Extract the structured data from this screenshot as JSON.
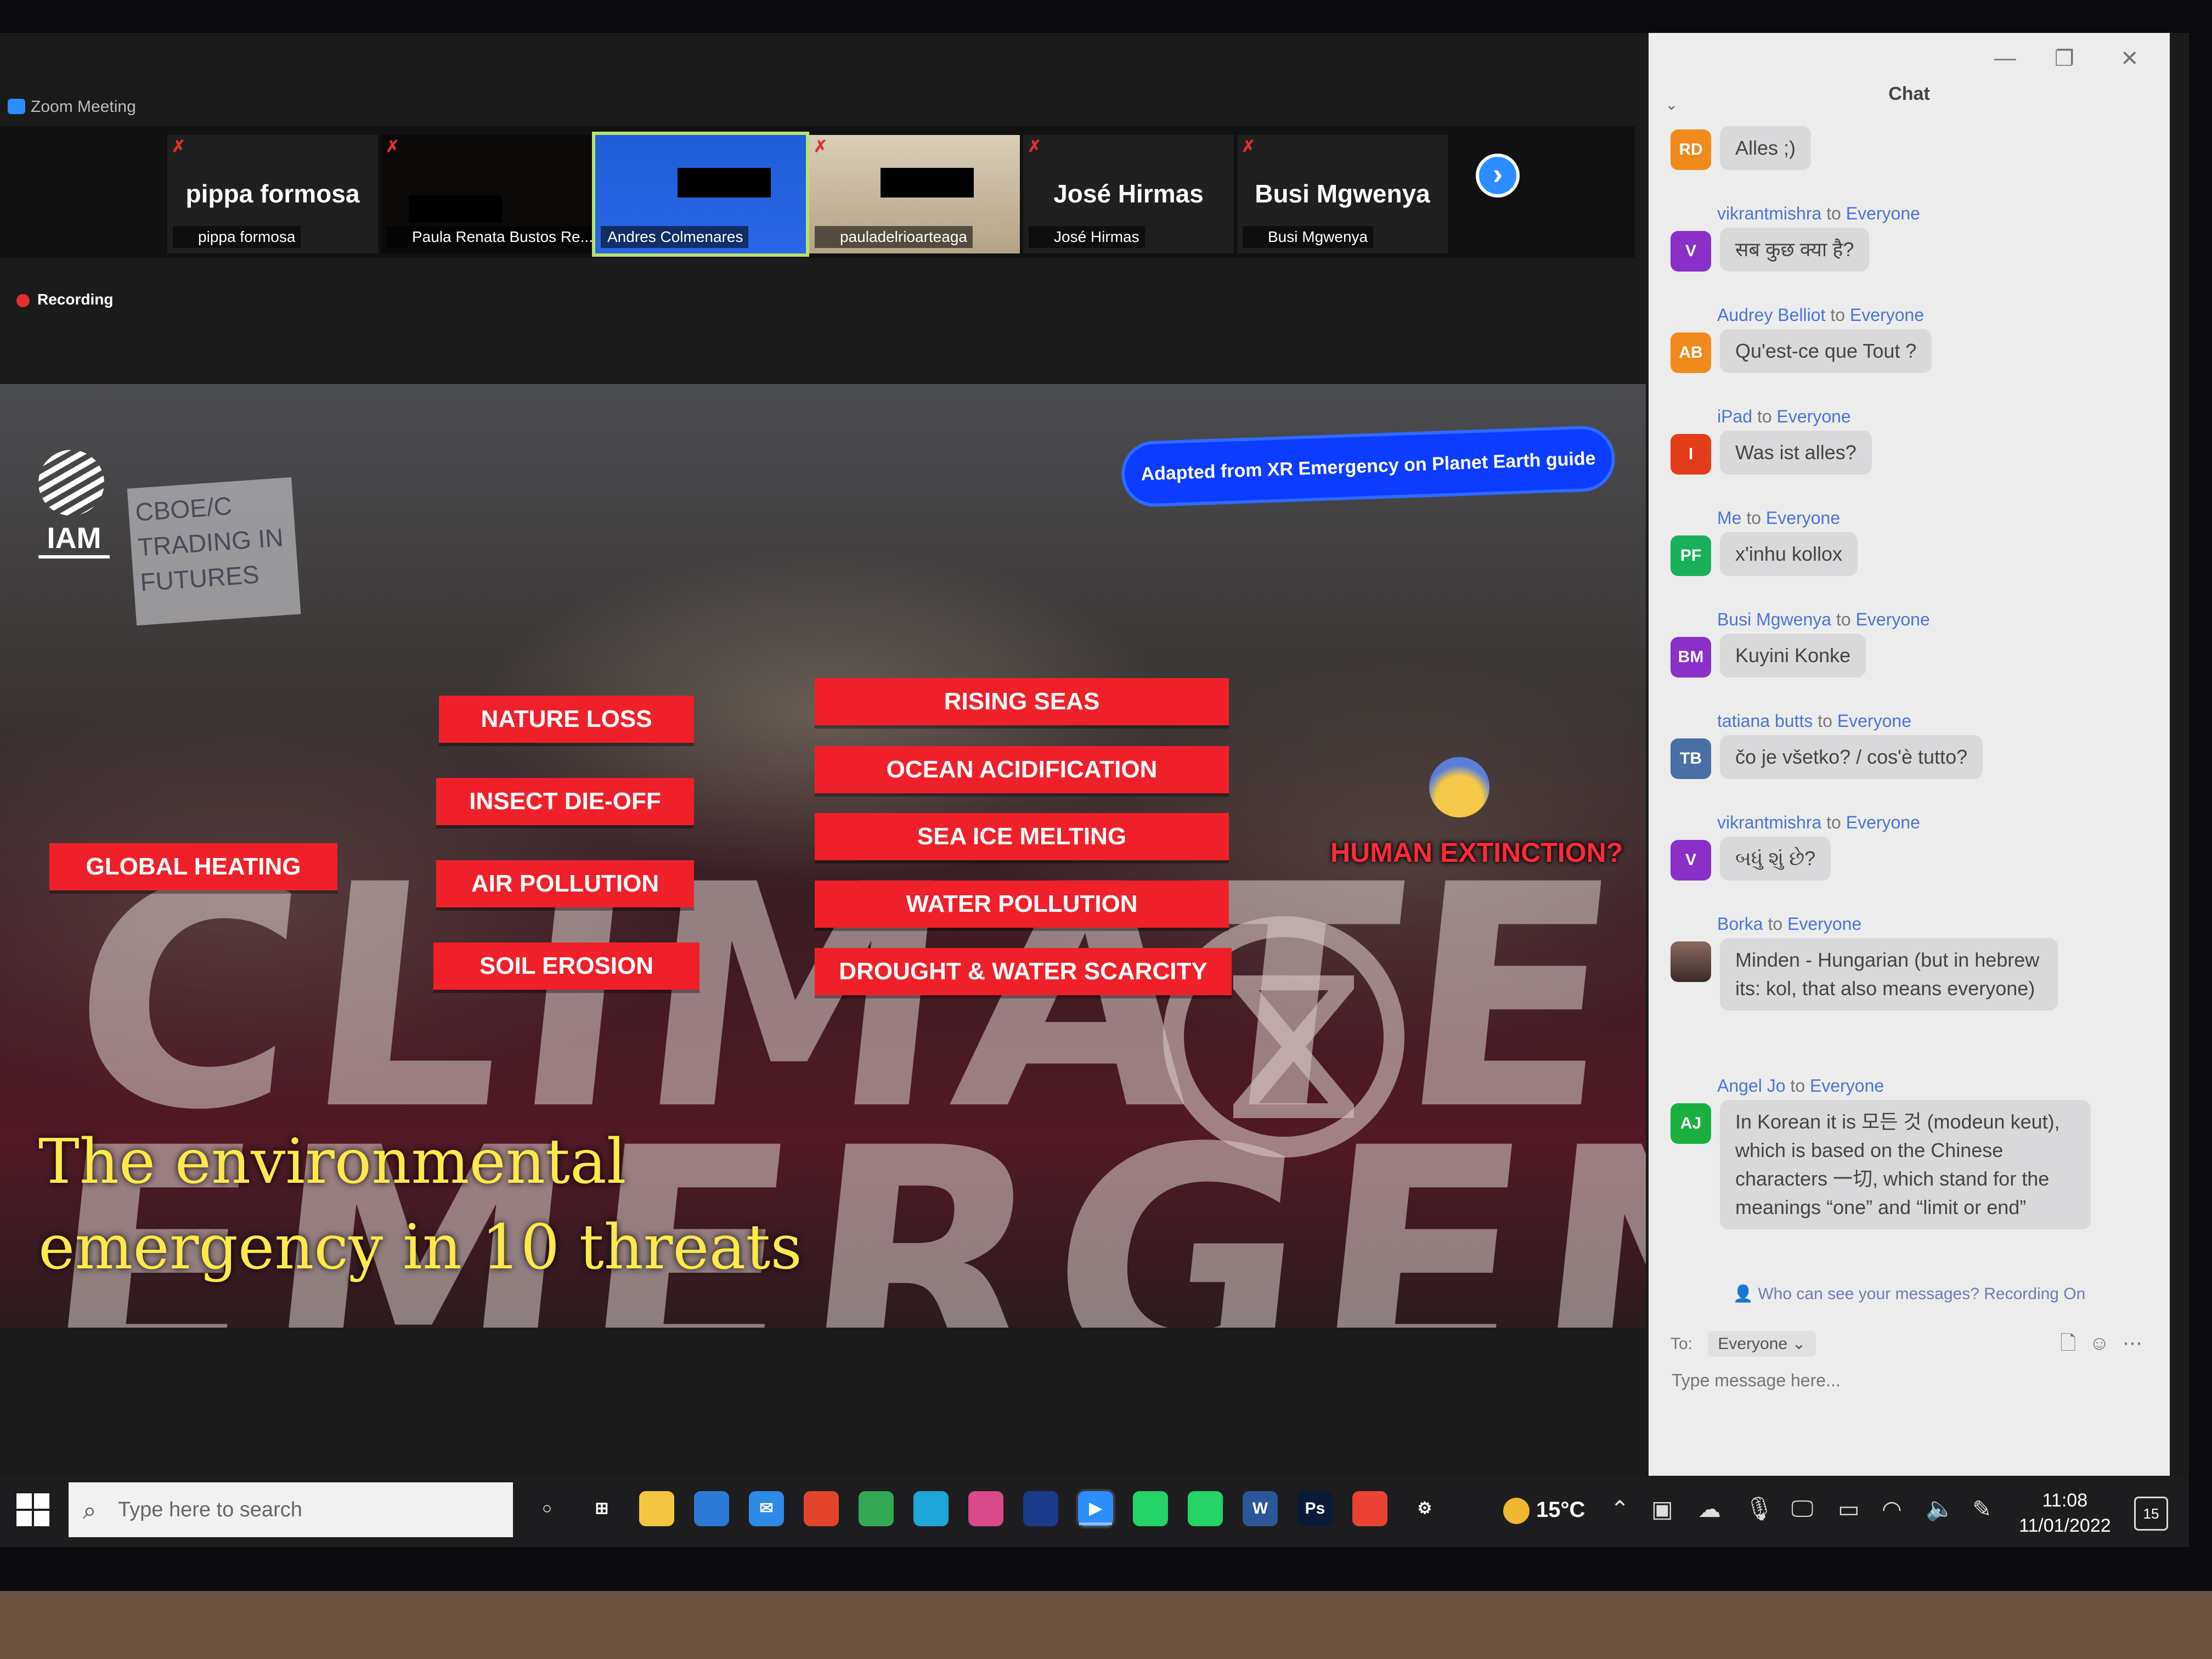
{
  "window": {
    "title": "Zoom Meeting"
  },
  "gallery": {
    "participants": [
      {
        "big_name": "pippa formosa",
        "label": "pippa formosa",
        "muted": true
      },
      {
        "big_name": "",
        "label": "Paula Renata Bustos Re...",
        "muted": true
      },
      {
        "big_name": "",
        "label": "Andres Colmenares",
        "muted": false
      },
      {
        "big_name": "",
        "label": "pauladelrioarteaga",
        "muted": true
      },
      {
        "big_name": "José Hirmas",
        "label": "José Hirmas",
        "muted": true
      },
      {
        "big_name": "Busi Mgwenya",
        "label": "Busi Mgwenya",
        "muted": true
      }
    ],
    "next_icon": "chevron-right-icon"
  },
  "recording": {
    "label": "Recording"
  },
  "slide": {
    "logo_text": "IAM",
    "sign_text": "CBOE/C TRADING IN FUTURES",
    "banner_text": "CLIMATE EMERGENCY",
    "adapted_label": "Adapted from XR Emergency on Planet Earth guide",
    "threats": [
      "GLOBAL HEATING",
      "NATURE LOSS",
      "INSECT DIE-OFF",
      "AIR POLLUTION",
      "SOIL EROSION",
      "RISING SEAS",
      "OCEAN ACIDIFICATION",
      "SEA ICE MELTING",
      "WATER POLLUTION",
      "DROUGHT & WATER SCARCITY"
    ],
    "human_extinction": "HUMAN EXTINCTION?",
    "title_line1": "The environmental",
    "title_line2": "emergency in 10 threats",
    "colors": {
      "threat": "#f0202a",
      "title": "#ffe94a",
      "pill": "#0c3cff"
    }
  },
  "chat": {
    "title": "Chat",
    "to_word": "to",
    "messages": [
      {
        "sender": "",
        "recipient": "",
        "initials": "RD",
        "color": "#f08a1c",
        "text": "Alles ;)"
      },
      {
        "sender": "vikrantmishra",
        "recipient": "Everyone",
        "initials": "V",
        "color": "#8a2fc8",
        "text": "सब कुछ क्या है?"
      },
      {
        "sender": "Audrey Belliot",
        "recipient": "Everyone",
        "initials": "AB",
        "color": "#f08a1c",
        "text": "Qu'est-ce que Tout ?"
      },
      {
        "sender": "iPad",
        "recipient": "Everyone",
        "initials": "I",
        "color": "#e23c1a",
        "text": "Was ist alles?"
      },
      {
        "sender": "Me",
        "recipient": "Everyone",
        "initials": "PF",
        "color": "#1ab05a",
        "text": "x'inhu kollox"
      },
      {
        "sender": "Busi Mgwenya",
        "recipient": "Everyone",
        "initials": "BM",
        "color": "#8a2fc8",
        "text": "Kuyini Konke"
      },
      {
        "sender": "tatiana butts",
        "recipient": "Everyone",
        "initials": "TB",
        "color": "#4a6fa5",
        "text": "čo je všetko? / cos'è tutto?"
      },
      {
        "sender": "vikrantmishra",
        "recipient": "Everyone",
        "initials": "V",
        "color": "#8a2fc8",
        "text": "બધું શું છે?"
      },
      {
        "sender": "Borka",
        "recipient": "Everyone",
        "initials": "",
        "color": "#8a6a60",
        "text": "Minden - Hungarian (but in hebrew its: kol, that also means everyone)"
      },
      {
        "sender": "Angel Jo",
        "recipient": "Everyone",
        "initials": "AJ",
        "color": "#1ab040",
        "text": "In Korean it is 모든 것 (modeun keut), which is based on the Chinese characters 一切, which stand for the meanings “one” and “limit or end”"
      }
    ],
    "visibility_note": "Who can see your messages? Recording On",
    "to_label": "To:",
    "to_value": "Everyone",
    "input_placeholder": "Type message here..."
  },
  "taskbar": {
    "search_placeholder": "Type here to search",
    "apps": [
      {
        "name": "cortana-icon",
        "label": "○",
        "color": "transparent"
      },
      {
        "name": "task-view-icon",
        "label": "⊞",
        "color": "transparent"
      },
      {
        "name": "file-explorer-icon",
        "label": "",
        "color": "#f4c542"
      },
      {
        "name": "store-icon",
        "label": "",
        "color": "#2d7ad6"
      },
      {
        "name": "mail-icon",
        "label": "✉",
        "color": "#2e8ae6"
      },
      {
        "name": "office-icon",
        "label": "",
        "color": "#e2452c"
      },
      {
        "name": "chrome-icon",
        "label": "",
        "color": "#34a853"
      },
      {
        "name": "edge-icon",
        "label": "",
        "color": "#1fa6d8"
      },
      {
        "name": "photos-icon",
        "label": "",
        "color": "#d84a8a"
      },
      {
        "name": "vpn-icon",
        "label": "",
        "color": "#1a3a8a"
      },
      {
        "name": "zoom-icon",
        "label": "▶",
        "color": "#2d8cff"
      },
      {
        "name": "whatsapp-icon",
        "label": "",
        "color": "#25d366"
      },
      {
        "name": "whatsapp-2-icon",
        "label": "",
        "color": "#25d366"
      },
      {
        "name": "word-icon",
        "label": "W",
        "color": "#2b579a"
      },
      {
        "name": "photoshop-icon",
        "label": "Ps",
        "color": "#0a1b3a"
      },
      {
        "name": "chrome-2-icon",
        "label": "",
        "color": "#ea4335"
      },
      {
        "name": "settings-icon",
        "label": "⚙",
        "color": "transparent"
      }
    ],
    "weather": "15°C",
    "time": "11:08",
    "date": "11/01/2022",
    "notifications": "15"
  }
}
